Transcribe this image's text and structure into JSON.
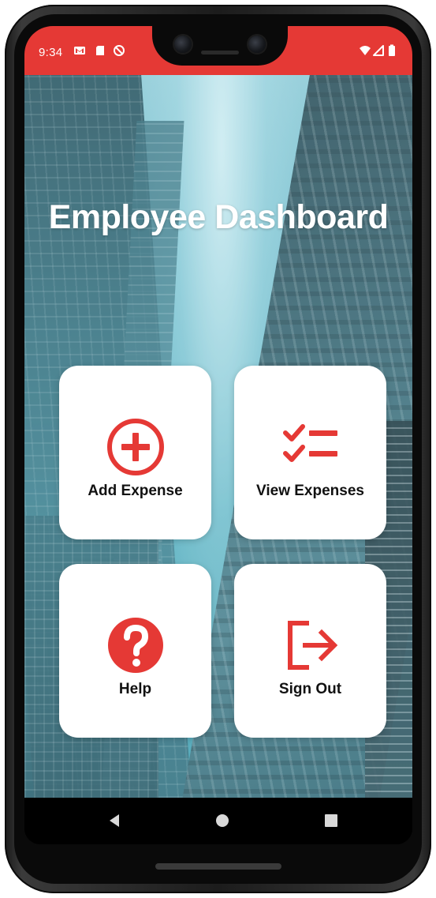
{
  "status_bar": {
    "time": "9:34",
    "left_icons": [
      "gmail-icon",
      "sd-card-icon",
      "do-not-disturb-icon"
    ],
    "right_icons": [
      "wifi-icon",
      "signal-icon",
      "battery-icon"
    ],
    "background_color": "#e53935"
  },
  "header": {
    "title": "Employee Dashboard"
  },
  "tiles": [
    {
      "label": "Add Expense",
      "icon": "add-circle-icon"
    },
    {
      "label": "View Expenses",
      "icon": "checklist-icon"
    },
    {
      "label": "Help",
      "icon": "help-circle-icon"
    },
    {
      "label": "Sign Out",
      "icon": "sign-out-icon"
    }
  ],
  "navigation": {
    "buttons": [
      "back-icon",
      "home-icon",
      "recents-icon"
    ]
  },
  "colors": {
    "accent": "#e53935",
    "tile_background": "#ffffff",
    "label_text": "#111111"
  }
}
